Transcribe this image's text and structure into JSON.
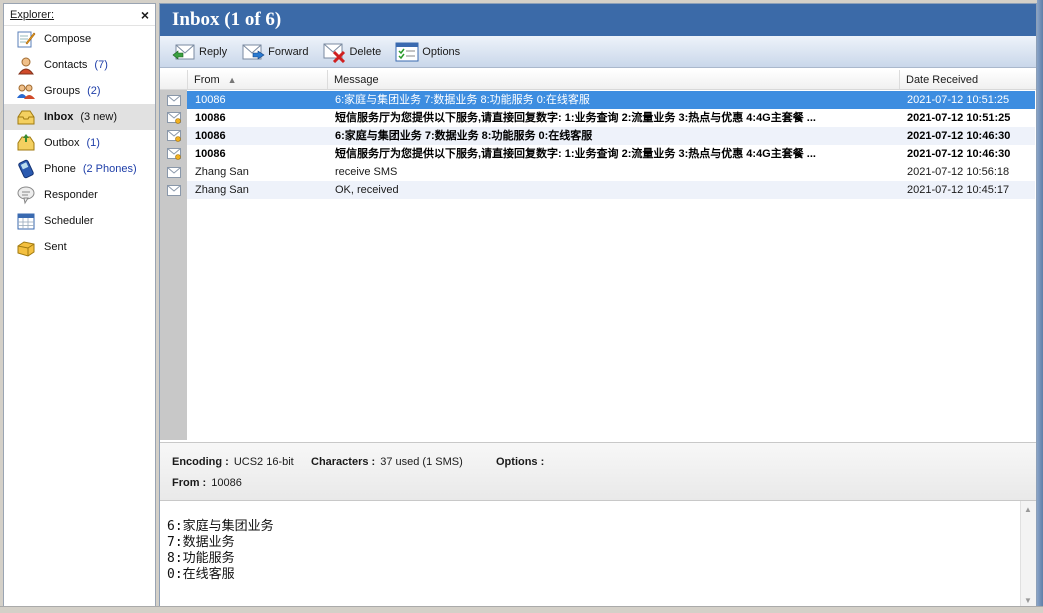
{
  "explorer": {
    "title": "Explorer:",
    "close_label": "×",
    "items": [
      {
        "label": "Compose",
        "count": "",
        "icon": "compose-icon"
      },
      {
        "label": "Contacts",
        "count": "(7)",
        "icon": "contacts-icon"
      },
      {
        "label": "Groups",
        "count": "(2)",
        "icon": "groups-icon"
      },
      {
        "label": "Inbox",
        "count": "(3 new)",
        "icon": "inbox-icon"
      },
      {
        "label": "Outbox",
        "count": "(1)",
        "icon": "outbox-icon"
      },
      {
        "label": "Phone",
        "count": "(2 Phones)",
        "icon": "phone-icon"
      },
      {
        "label": "Responder",
        "count": "",
        "icon": "responder-icon"
      },
      {
        "label": "Scheduler",
        "count": "",
        "icon": "scheduler-icon"
      },
      {
        "label": "Sent",
        "count": "",
        "icon": "sent-icon"
      }
    ]
  },
  "main": {
    "title": "Inbox (1 of 6)",
    "toolbar": {
      "reply": "Reply",
      "forward": "Forward",
      "delete": "Delete",
      "options": "Options"
    },
    "columns": {
      "from": "From",
      "message": "Message",
      "date": "Date Received"
    },
    "rows": [
      {
        "from": "10086",
        "message": " 6:家庭与集团业务 7:数据业务 8:功能服务 0:在线客服",
        "date": "2021-07-12 10:51:25",
        "unread": false
      },
      {
        "from": "10086",
        "message": "短信服务厅为您提供以下服务,请直接回复数字: 1:业务查询 2:流量业务 3:热点与优惠 4:4G主套餐 ...",
        "date": "2021-07-12 10:51:25",
        "unread": true
      },
      {
        "from": "10086",
        "message": " 6:家庭与集团业务 7:数据业务 8:功能服务 0:在线客服",
        "date": "2021-07-12 10:46:30",
        "unread": true
      },
      {
        "from": "10086",
        "message": "短信服务厅为您提供以下服务,请直接回复数字: 1:业务查询 2:流量业务 3:热点与优惠 4:4G主套餐 ...",
        "date": "2021-07-12 10:46:30",
        "unread": true
      },
      {
        "from": "Zhang San",
        "message": "receive SMS",
        "date": "2021-07-12 10:56:18",
        "unread": false
      },
      {
        "from": "Zhang San",
        "message": "OK, received",
        "date": "2021-07-12 10:45:17",
        "unread": false
      }
    ],
    "info": {
      "encoding_label": "Encoding :",
      "encoding_value": "UCS2 16-bit",
      "characters_label": "Characters :",
      "characters_value": "37 used (1 SMS)",
      "options_label": "Options :",
      "from_label": "From :",
      "from_value": "10086"
    },
    "preview_body": "6:家庭与集团业务\n7:数据业务\n8:功能服务\n0:在线客服"
  },
  "colors": {
    "title_bar": "#3b6aa8",
    "selection": "#3d8de0",
    "count_text": "#1e3ea8"
  }
}
